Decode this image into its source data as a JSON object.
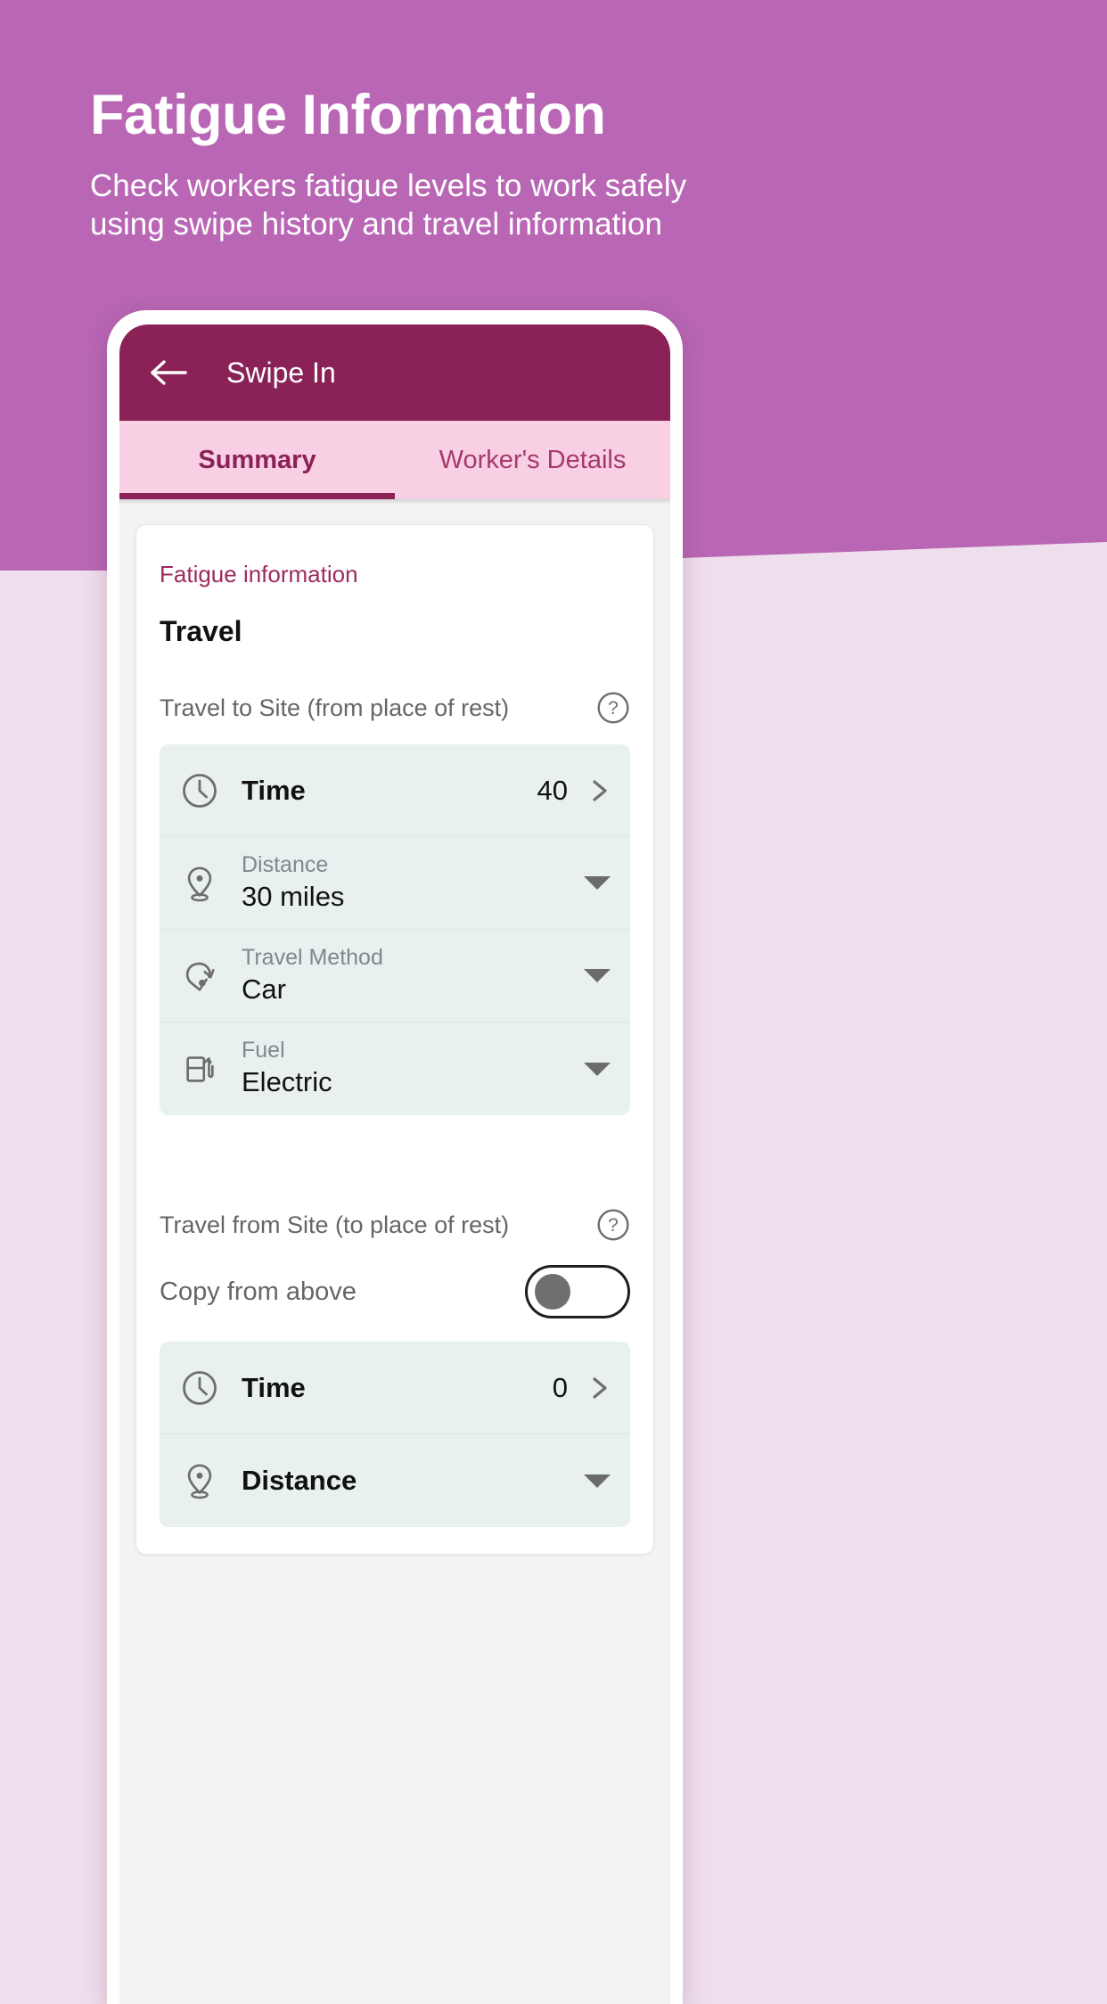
{
  "hero": {
    "title": "Fatigue Information",
    "subtitle": "Check workers fatigue levels to work safely using swipe history and travel information",
    "bg_color": "#b967b5",
    "page_bg_color": "#efdeec"
  },
  "appbar": {
    "title": "Swipe In",
    "back_icon": "arrow-left-icon",
    "bg_color": "#8a2257"
  },
  "tabs": {
    "items": [
      {
        "label": "Summary",
        "active": true
      },
      {
        "label": "Worker's Details",
        "active": false
      }
    ],
    "bg_color": "#f9cfe3",
    "indicator_color": "#8a2257"
  },
  "card": {
    "eyebrow": "Fatigue information",
    "heading": "Travel",
    "eyebrow_color": "#9c2a5e"
  },
  "section_to_site": {
    "label": "Travel to Site (from place of rest)",
    "help_icon": "question-circle-icon",
    "fields": [
      {
        "icon": "clock-icon",
        "title": "Time",
        "value": "40",
        "affordance": "chevron-right-icon"
      },
      {
        "icon": "location-pin-icon",
        "label": "Distance",
        "value": "30 miles",
        "affordance": "caret-down-icon"
      },
      {
        "icon": "travel-method-icon",
        "label": "Travel Method",
        "value": "Car",
        "affordance": "caret-down-icon"
      },
      {
        "icon": "fuel-pump-icon",
        "label": "Fuel",
        "value": "Electric",
        "affordance": "caret-down-icon"
      }
    ]
  },
  "section_from_site": {
    "label": "Travel from Site (to place of rest)",
    "help_icon": "question-circle-icon",
    "copy_from_above_label": "Copy from above",
    "copy_from_above_state": "off",
    "fields": [
      {
        "icon": "clock-icon",
        "title": "Time",
        "value": "0",
        "affordance": "chevron-right-icon"
      },
      {
        "icon": "location-pin-icon",
        "title": "Distance",
        "value": "",
        "affordance": "caret-down-icon"
      }
    ]
  }
}
